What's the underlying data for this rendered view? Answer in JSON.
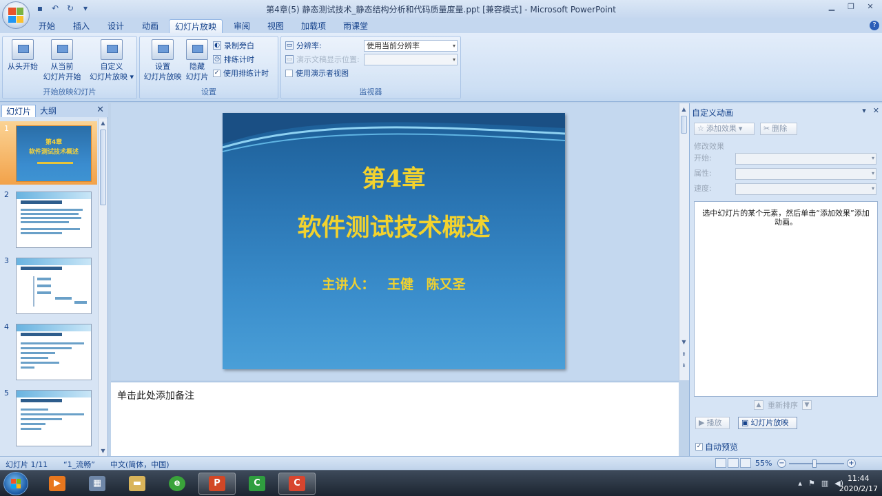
{
  "window": {
    "title": "第4章(5) 静态测试技术_静态结构分析和代码质量度量.ppt [兼容模式] - Microsoft PowerPoint"
  },
  "tabs": [
    "开始",
    "插入",
    "设计",
    "动画",
    "幻灯片放映",
    "审阅",
    "视图",
    "加载项",
    "雨课堂"
  ],
  "active_tab": "幻灯片放映",
  "ribbon": {
    "group_start": {
      "label": "开始放映幻灯片",
      "from_start": "从头开始",
      "from_current_1": "从当前",
      "from_current_2": "幻灯片开始",
      "custom_1": "自定义",
      "custom_2": "幻灯片放映"
    },
    "group_setup": {
      "label": "设置",
      "setup_1": "设置",
      "setup_2": "幻灯片放映",
      "hide_1": "隐藏",
      "hide_2": "幻灯片",
      "record": "录制旁白",
      "rehearse": "排练计时",
      "use_timings": "使用排练计时"
    },
    "group_monitors": {
      "label": "监视器",
      "resolution_label": "分辨率:",
      "resolution_value": "使用当前分辨率",
      "show_on_label": "演示文稿显示位置:",
      "presenter_view": "使用演示者视图"
    }
  },
  "left_panel": {
    "tab_slides": "幻灯片",
    "tab_outline": "大纲",
    "slide_numbers": [
      "1",
      "2",
      "3",
      "4",
      "5"
    ]
  },
  "slide": {
    "chapter": "第4章",
    "title": "软件测试技术概述",
    "presenters": "主讲人： 王健 陈又圣"
  },
  "thumb1": {
    "chapter": "第4章",
    "title": "软件测试技术概述"
  },
  "notes": {
    "placeholder": "单击此处添加备注"
  },
  "right_panel": {
    "title": "自定义动画",
    "add_effect": "添加效果",
    "remove": "删除",
    "modify_effect": "修改效果",
    "start_label": "开始:",
    "property_label": "属性:",
    "speed_label": "速度:",
    "hint": "选中幻灯片的某个元素，然后单击“添加效果”添加动画。",
    "reorder": "重新排序",
    "play": "播放",
    "slideshow": "幻灯片放映",
    "auto_preview": "自动预览"
  },
  "statusbar": {
    "slide_info": "幻灯片 1/11",
    "theme": "“1_流畅”",
    "language": "中文(简体，中国)",
    "zoom": "55%"
  },
  "taskbar": {
    "time": "11:44",
    "date": "2020/2/17"
  }
}
